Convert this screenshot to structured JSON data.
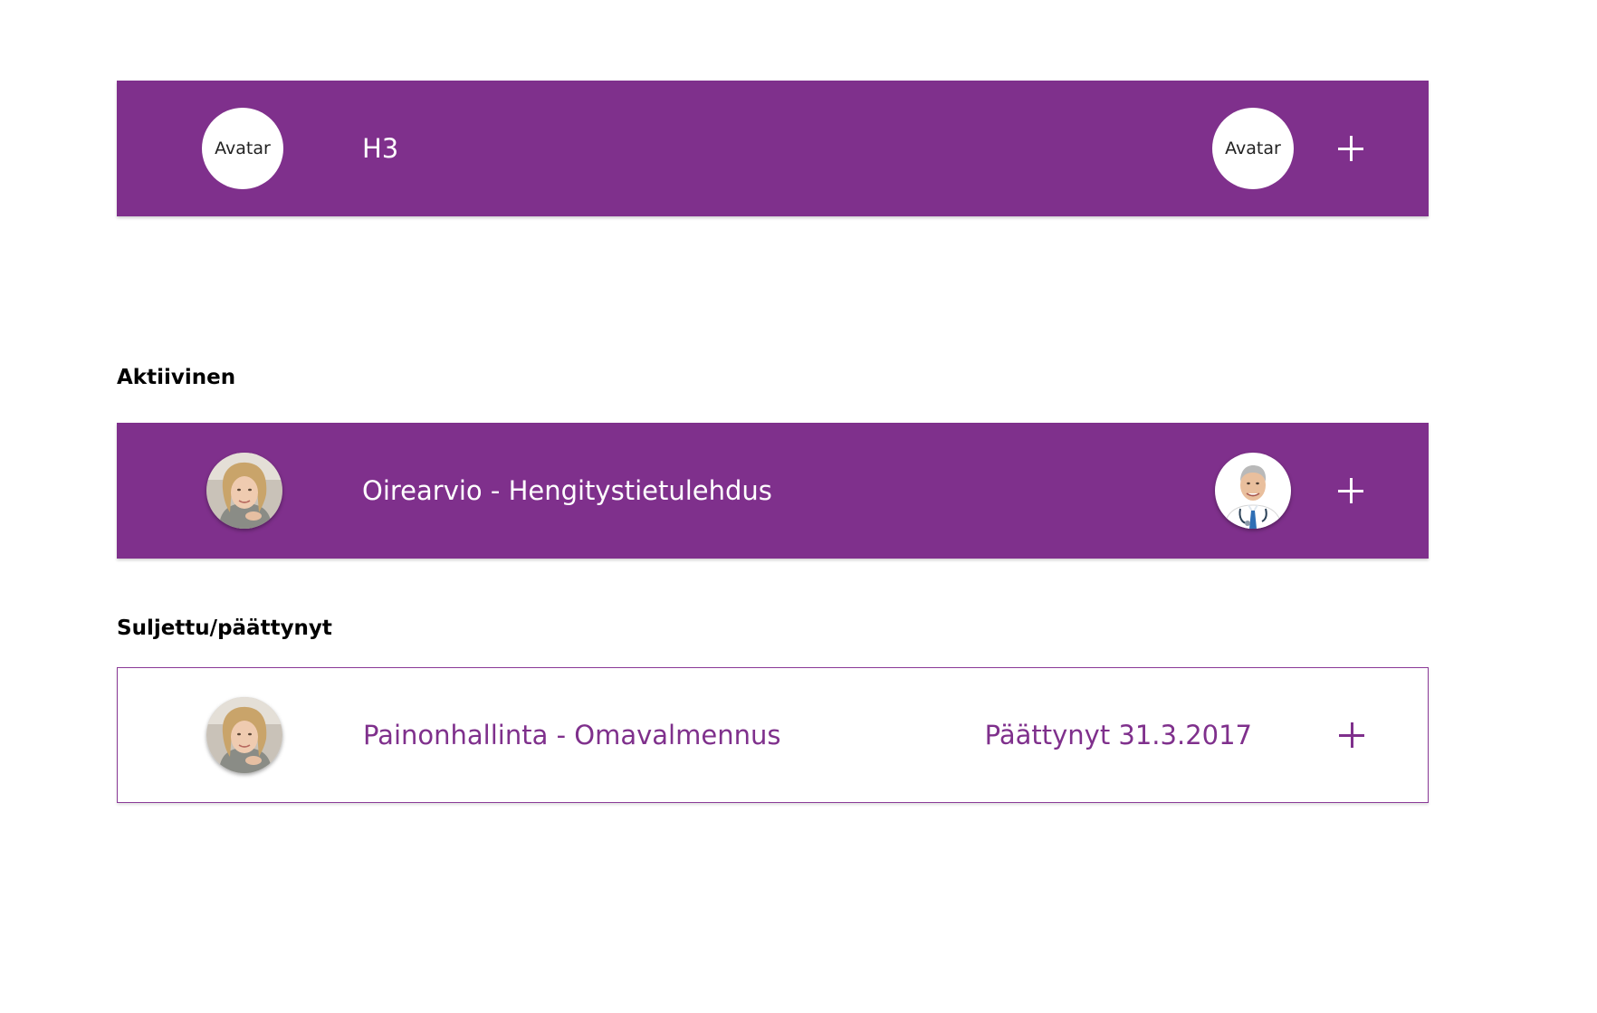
{
  "template_bar": {
    "left_avatar_label": "Avatar",
    "title": "H3",
    "right_avatar_label": "Avatar",
    "colors": {
      "background": "#7f308c",
      "text": "#ffffff"
    },
    "action_icon": "plus-icon"
  },
  "sections": {
    "active": {
      "heading": "Aktiivinen",
      "item": {
        "title": "Oirearvio - Hengitystietulehdus",
        "left_avatar_icon": "patient-avatar-icon",
        "right_avatar_icon": "doctor-avatar-icon",
        "action_icon": "plus-icon"
      }
    },
    "closed": {
      "heading": "Suljettu/päättynyt",
      "item": {
        "title": "Painonhallinta - Omavalmennus",
        "status": "Päättynyt 31.3.2017",
        "left_avatar_icon": "patient-avatar-icon",
        "action_icon": "plus-icon"
      }
    }
  },
  "colors": {
    "brand_purple": "#7f308c",
    "outline": "#8a3a97",
    "heading_text": "#000000"
  }
}
